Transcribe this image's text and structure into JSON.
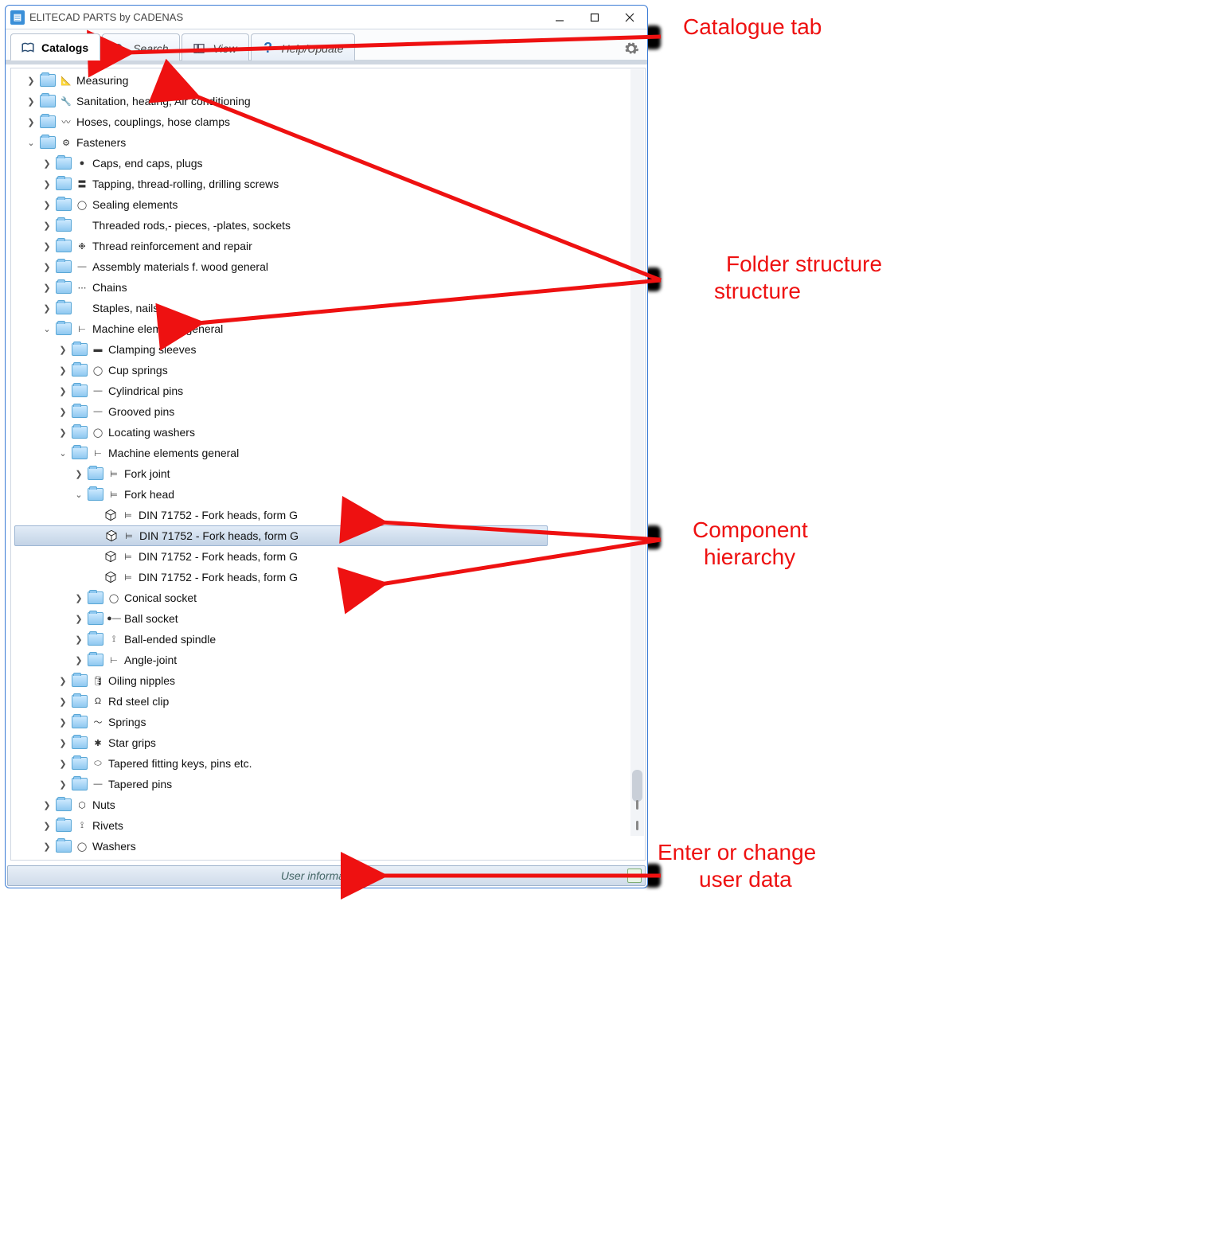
{
  "window": {
    "title": "ELITECAD PARTS by CADENAS"
  },
  "tabs": {
    "catalogs": "Catalogs",
    "search": "Search",
    "view": "View",
    "help": "Help/Update"
  },
  "tree": {
    "measuring": "Measuring",
    "sanitation": "Sanitation, heating, Air conditioning",
    "hoses": "Hoses, couplings, hose clamps",
    "fasteners": "Fasteners",
    "caps": "Caps, end caps, plugs",
    "tapping": "Tapping, thread-rolling, drilling screws",
    "sealing": "Sealing elements",
    "threaded_rods": "Threaded rods,- pieces, -plates, sockets",
    "thread_reinf": "Thread reinforcement and repair",
    "assembly_wood": "Assembly materials f. wood general",
    "chains": "Chains",
    "staples": "Staples, nails",
    "machine_elem": "Machine elements general",
    "clamping": "Clamping sleeves",
    "cup_springs": "Cup springs",
    "cyl_pins": "Cylindrical pins",
    "grooved_pins": "Grooved pins",
    "loc_washers": "Locating washers",
    "machine_elem2": "Machine elements general",
    "fork_joint": "Fork joint",
    "fork_head": "Fork head",
    "din1": "DIN 71752 - Fork heads, form G",
    "din2": "DIN 71752 - Fork heads, form G",
    "din3": "DIN 71752 - Fork heads, form G",
    "din4": "DIN 71752 - Fork heads, form G",
    "conical": "Conical socket",
    "ball_socket": "Ball socket",
    "ball_spindle": "Ball-ended spindle",
    "angle_joint": "Angle-joint",
    "oiling": "Oiling nipples",
    "rd_steel": "Rd steel clip",
    "springs": "Springs",
    "star_grips": "Star grips",
    "tapered_keys": "Tapered fitting keys, pins etc.",
    "tapered_pins": "Tapered pins",
    "nuts": "Nuts",
    "rivets": "Rivets",
    "washers": "Washers"
  },
  "footer": {
    "user_info": "User information..."
  },
  "annotations": {
    "catalogue_tab": "Catalogue tab",
    "folder_structure": "Folder structure",
    "folder_structure2": "structure",
    "component_hierarchy": "Component",
    "component_hierarchy2": "hierarchy",
    "user_data": "Enter or change",
    "user_data2": "user data"
  }
}
